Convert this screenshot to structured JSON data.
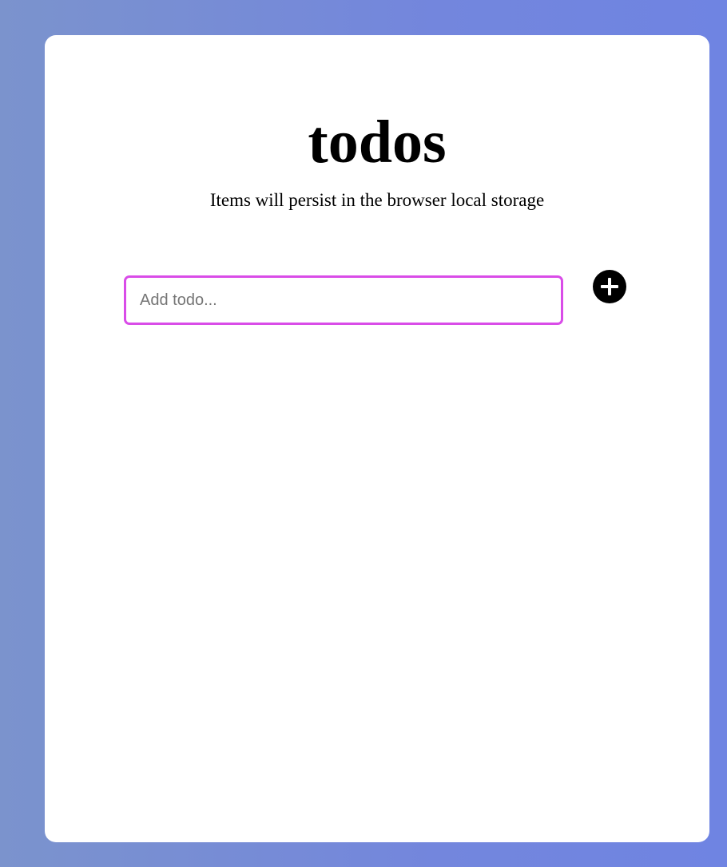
{
  "app": {
    "title": "todos",
    "subtitle": "Items will persist in the browser local storage"
  },
  "todo_form": {
    "input_value": "",
    "input_placeholder": "Add todo...",
    "add_icon": "plus-circle-icon"
  },
  "colors": {
    "background_gradient_start": "#7b93cd",
    "background_gradient_end": "#6f84e2",
    "input_focus_border": "#d94ce8",
    "add_button": "#000000"
  },
  "todos": []
}
